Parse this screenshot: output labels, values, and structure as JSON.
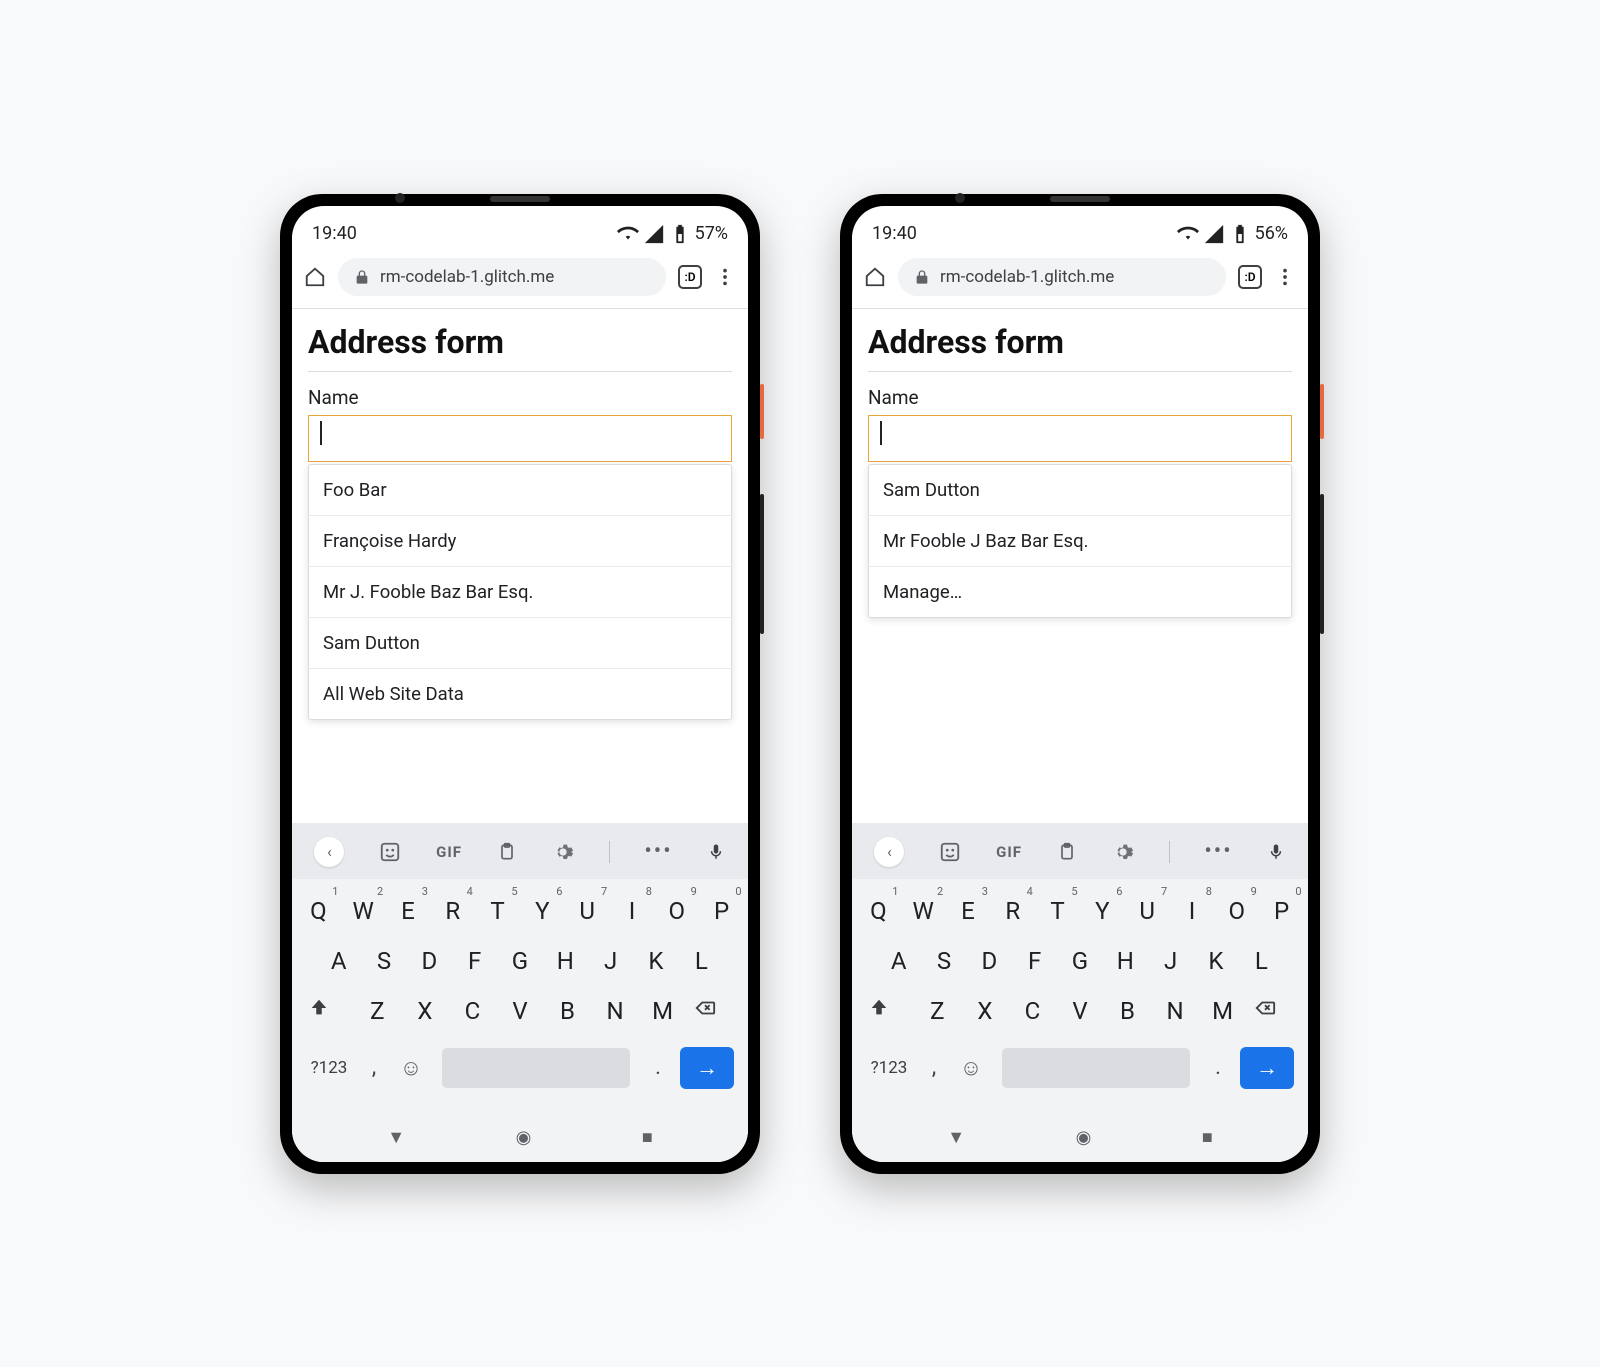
{
  "phones": [
    {
      "status": {
        "time": "19:40",
        "battery": "57%"
      },
      "browser": {
        "url": "rm-codelab-1.glitch.me",
        "tab_badge": ":D"
      },
      "page": {
        "title": "Address form",
        "name_label": "Name",
        "name_value": "",
        "suggestions": [
          "Foo Bar",
          "Françoise Hardy",
          "Mr J. Fooble Baz Bar Esq.",
          "Sam Dutton",
          "All Web Site Data"
        ]
      }
    },
    {
      "status": {
        "time": "19:40",
        "battery": "56%"
      },
      "browser": {
        "url": "rm-codelab-1.glitch.me",
        "tab_badge": ":D"
      },
      "page": {
        "title": "Address form",
        "name_label": "Name",
        "name_value": "",
        "suggestions": [
          "Sam Dutton",
          "Mr Fooble J Baz Bar Esq.",
          "Manage…"
        ]
      }
    }
  ],
  "keyboard": {
    "toolbar_gif": "GIF",
    "row1": [
      {
        "k": "Q",
        "n": "1"
      },
      {
        "k": "W",
        "n": "2"
      },
      {
        "k": "E",
        "n": "3"
      },
      {
        "k": "R",
        "n": "4"
      },
      {
        "k": "T",
        "n": "5"
      },
      {
        "k": "Y",
        "n": "6"
      },
      {
        "k": "U",
        "n": "7"
      },
      {
        "k": "I",
        "n": "8"
      },
      {
        "k": "O",
        "n": "9"
      },
      {
        "k": "P",
        "n": "0"
      }
    ],
    "row2": [
      "A",
      "S",
      "D",
      "F",
      "G",
      "H",
      "J",
      "K",
      "L"
    ],
    "row3": [
      "Z",
      "X",
      "C",
      "V",
      "B",
      "N",
      "M"
    ],
    "sym": "?123",
    "comma": ",",
    "period": "."
  }
}
